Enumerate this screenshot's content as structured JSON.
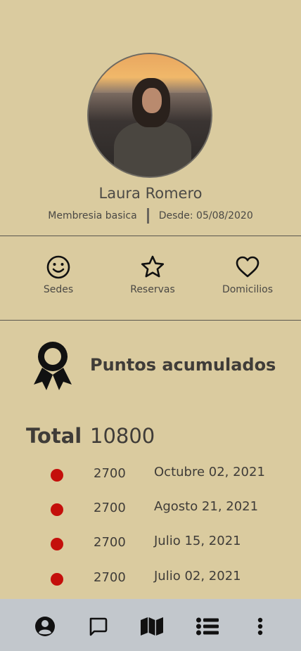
{
  "profile": {
    "name": "Laura Romero",
    "membership": "Membresia basica",
    "since": "Desde: 05/08/2020"
  },
  "actions": [
    {
      "label": "Sedes",
      "icon": "smiley-icon"
    },
    {
      "label": "Reservas",
      "icon": "star-icon"
    },
    {
      "label": "Domicilios",
      "icon": "heart-icon"
    }
  ],
  "points": {
    "title": "Puntos acumulados",
    "icon": "award-ribbon-icon",
    "total_label": "Total",
    "total_value": "10800",
    "entries": [
      {
        "points": "2700",
        "date": "Octubre 02, 2021"
      },
      {
        "points": "2700",
        "date": "Agosto 21, 2021"
      },
      {
        "points": "2700",
        "date": "Julio 15, 2021"
      },
      {
        "points": "2700",
        "date": "Julio 02, 2021"
      }
    ]
  },
  "bottom_nav": [
    {
      "icon": "user-circle-icon"
    },
    {
      "icon": "chat-icon"
    },
    {
      "icon": "map-icon"
    },
    {
      "icon": "list-icon"
    },
    {
      "icon": "more-vertical-icon"
    }
  ],
  "colors": {
    "background": "#dacb9f",
    "bottom_nav": "#c2c7cc",
    "dot": "#c40f0b",
    "text": "#3f3c38"
  }
}
